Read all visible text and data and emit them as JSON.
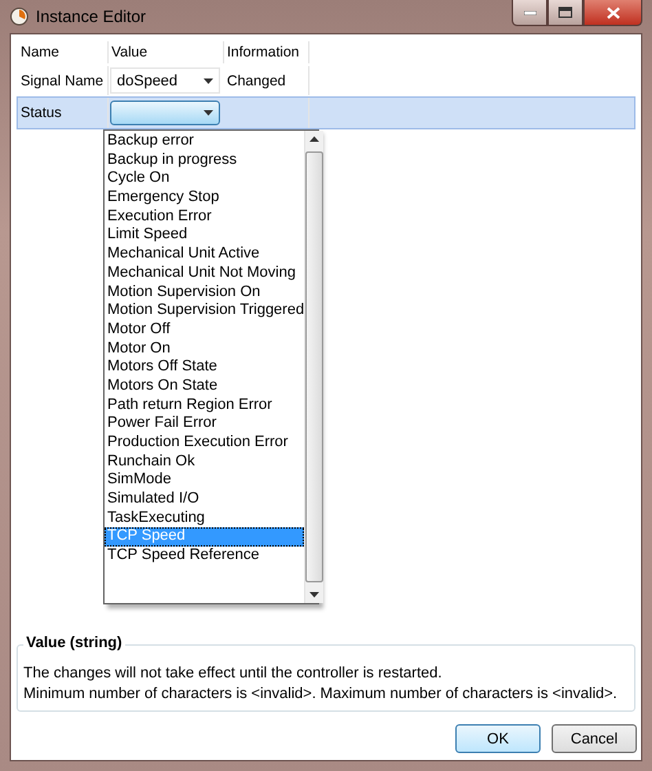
{
  "window": {
    "title": "Instance Editor"
  },
  "table": {
    "columns": [
      "Name",
      "Value",
      "Information"
    ],
    "rows": [
      {
        "name": "Signal Name",
        "value": "doSpeed",
        "information": "Changed",
        "selected": false
      },
      {
        "name": "Status",
        "value": "",
        "information": "",
        "selected": true
      }
    ]
  },
  "dropdown": {
    "items": [
      {
        "label": "Backup error",
        "selected": false
      },
      {
        "label": "Backup in progress",
        "selected": false
      },
      {
        "label": "Cycle On",
        "selected": false
      },
      {
        "label": "Emergency Stop",
        "selected": false
      },
      {
        "label": "Execution Error",
        "selected": false
      },
      {
        "label": "Limit Speed",
        "selected": false
      },
      {
        "label": "Mechanical Unit Active",
        "selected": false
      },
      {
        "label": "Mechanical Unit Not Moving",
        "selected": false
      },
      {
        "label": "Motion Supervision On",
        "selected": false
      },
      {
        "label": "Motion Supervision Triggered",
        "selected": false
      },
      {
        "label": "Motor Off",
        "selected": false
      },
      {
        "label": "Motor On",
        "selected": false
      },
      {
        "label": "Motors Off State",
        "selected": false
      },
      {
        "label": "Motors On State",
        "selected": false
      },
      {
        "label": "Path return Region Error",
        "selected": false
      },
      {
        "label": "Power Fail Error",
        "selected": false
      },
      {
        "label": "Production Execution Error",
        "selected": false
      },
      {
        "label": "Runchain Ok",
        "selected": false
      },
      {
        "label": "SimMode",
        "selected": false
      },
      {
        "label": "Simulated I/O",
        "selected": false
      },
      {
        "label": "TaskExecuting",
        "selected": false
      },
      {
        "label": "TCP Speed",
        "selected": true
      },
      {
        "label": "TCP Speed Reference",
        "selected": false
      }
    ]
  },
  "info": {
    "title": "Value (string)",
    "lines": [
      "The changes will not take effect until the controller is restarted.",
      "Minimum number of characters is <invalid>. Maximum number of characters is <invalid>."
    ]
  },
  "buttons": [
    {
      "label": "OK",
      "default": true
    },
    {
      "label": "Cancel",
      "default": false
    }
  ]
}
